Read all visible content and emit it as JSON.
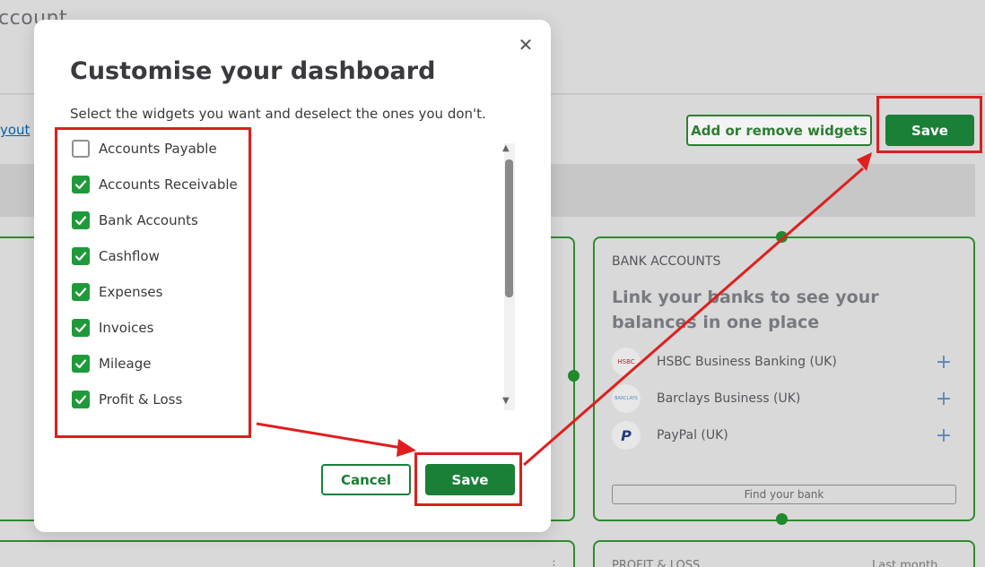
{
  "background": {
    "page_title": "ccount",
    "layout_link": "yout",
    "add_widgets_label": "Add or remove widgets",
    "save_label": "Save",
    "bank_card": {
      "heading": "BANK ACCOUNTS",
      "promo": "Link your banks to see your balances in one place",
      "banks": [
        {
          "name": "HSBC Business Banking (UK)",
          "logo_text": "HSBC",
          "logo_icon": "hsbc-logo-icon"
        },
        {
          "name": "Barclays Business (UK)",
          "logo_text": "BARCLAYS",
          "logo_icon": "barclays-logo-icon"
        },
        {
          "name": "PayPal (UK)",
          "logo_text": "P",
          "logo_icon": "paypal-logo-icon"
        }
      ],
      "add_icon": "plus-icon",
      "find_bank_label": "Find your bank"
    },
    "pl_card": {
      "heading": "PROFIT & LOSS",
      "period": "Last month"
    }
  },
  "modal": {
    "title": "Customise your dashboard",
    "subtitle": "Select the widgets you want and deselect the ones you don't.",
    "close_icon": "close-icon",
    "widgets": [
      {
        "label": "Accounts Payable",
        "checked": false
      },
      {
        "label": "Accounts Receivable",
        "checked": true
      },
      {
        "label": "Bank Accounts",
        "checked": true
      },
      {
        "label": "Cashflow",
        "checked": true
      },
      {
        "label": "Expenses",
        "checked": true
      },
      {
        "label": "Invoices",
        "checked": true
      },
      {
        "label": "Mileage",
        "checked": true
      },
      {
        "label": "Profit & Loss",
        "checked": true
      }
    ],
    "cancel_label": "Cancel",
    "save_label": "Save"
  },
  "colors": {
    "brand_green": "#1a7f37",
    "checkbox_green": "#1f9a3a",
    "annotation_red": "#d92020"
  }
}
